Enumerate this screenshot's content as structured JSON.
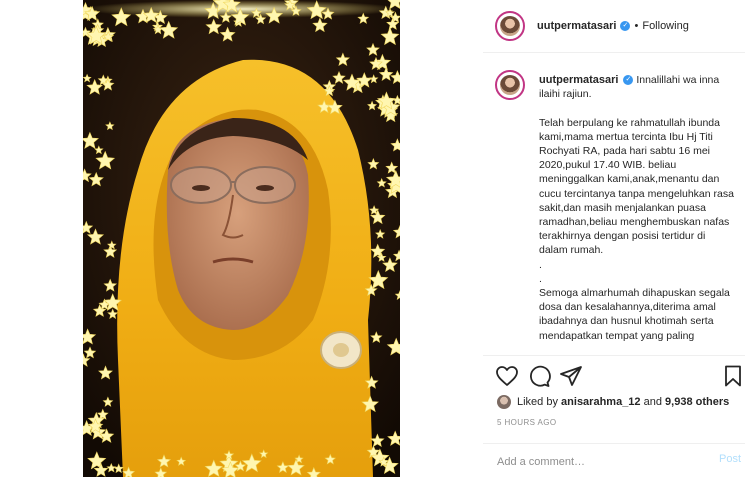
{
  "post": {
    "username": "uutpermatasari",
    "verified_symbol": "✓",
    "separator": "•",
    "follow_status": "Following"
  },
  "caption": {
    "username": "uutpermatasari",
    "text": "Innalillahi wa inna ilaihi rajiun.\n\nTelah berpulang ke rahmatullah ibunda kami,mama mertua tercinta Ibu Hj Titi Rochyati RA, pada hari sabtu 16 mei 2020,pukul 17.40 WIB. beliau meninggalkan kami,anak,menantu dan cucu tercintanya tanpa mengeluhkan rasa sakit,dan masih menjalankan puasa ramadhan,beliau menghembuskan nafas terakhirnya dengan posisi tertidur di dalam rumah.\n.\n.\nSemoga almarhumah dihapuskan segala dosa dan kesalahannya,diterima amal ibadahnya dan husnul khotimah serta mendapatkan tempat yang paling"
  },
  "likes": {
    "prefix": "Liked by",
    "user": "anisarahma_12",
    "connector": "and",
    "count": "9,938 others"
  },
  "timestamp": "5 HOURS AGO",
  "comment": {
    "placeholder": "Add a comment…",
    "post_label": "Post"
  },
  "icons": {
    "like": "heart-icon",
    "comment": "comment-bubble-icon",
    "share": "paper-plane-icon",
    "save": "bookmark-icon"
  },
  "colors": {
    "verified": "#3897f0",
    "hijab": "#f2b51c",
    "border_stars": "#fff3a0",
    "post_disabled": "#b2dffc",
    "muted_text": "#8e8e8e"
  }
}
